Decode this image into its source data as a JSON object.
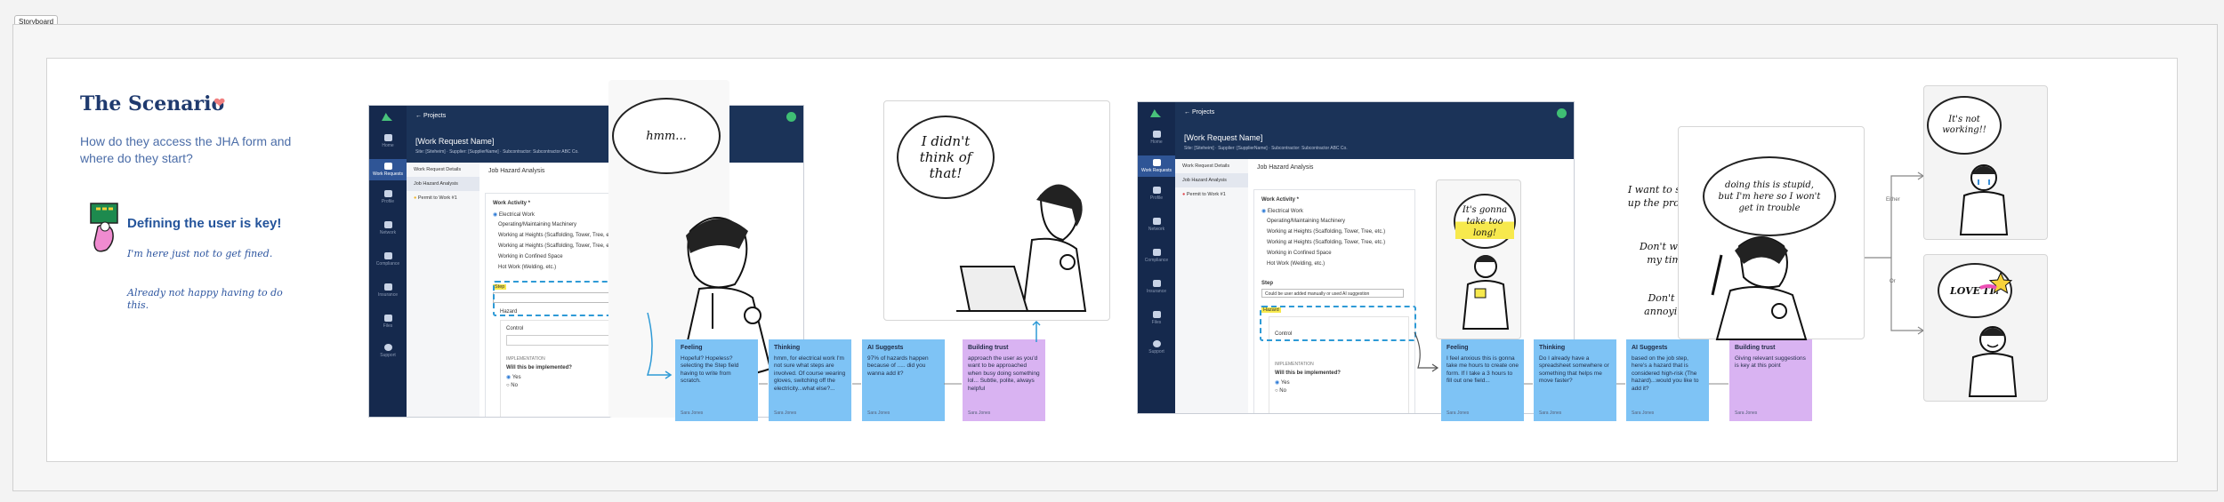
{
  "frame": {
    "label": "Storyboard"
  },
  "intro": {
    "title": "The Scenario",
    "question": "How do they access the JHA form and where do they start?",
    "key_point": "Defining the user is key!",
    "quotes": [
      "I'm here just not to get fined.",
      "Already not happy having to do this."
    ]
  },
  "app": {
    "nav": [
      "Home",
      "Work Requests",
      "Profile",
      "Network",
      "Compliance",
      "Insurance",
      "Files",
      "Support"
    ],
    "back_label": "Projects",
    "request_name": "[Work Request Name]",
    "request_meta": "Site: [Siteheim]  ·  Supplier: [SupplierName]  ·  Subcontractor: Subcontractor ABC Co.",
    "left_menu": [
      "Work Request Details",
      "Job Hazard Analysis",
      "Permit to Work #1"
    ],
    "section_title": "Job Hazard Analysis",
    "work_activity_label": "Work Activity *",
    "activities": [
      "Electrical Work",
      "Operating/Maintaining Machinery",
      "Working at Heights (Scaffolding, Tower, Tree, etc.)",
      "Working at Heights (Scaffolding, Tower, Tree, etc.)",
      "Working in Confined Space",
      "Hot Work (Welding, etc.)"
    ],
    "step_label": "Step",
    "hazard_label": "Hazard",
    "control_label": "Control",
    "implementation_label": "IMPLEMENTATION",
    "implemented_question": "Will this be implemented?",
    "yes": "Yes",
    "no": "No",
    "step_value_2": "Could be user added manually or used AI suggestion"
  },
  "panel1": {
    "cloud1": "hmm...",
    "cloud2": "I didn't think of that!",
    "stickies": [
      {
        "title": "Feeling",
        "body": "Hopeful? Hopeless? selecting the Step field having to write from scratch.",
        "sig": "Sara Jones"
      },
      {
        "title": "Thinking",
        "body": "hmm, for electrical work I'm not sure what steps are involved. Of course wearing gloves, switching off the electricity...what else?...",
        "sig": "Sara Jones"
      },
      {
        "title": "AI Suggests",
        "body": "97% of hazards happen because of ..... did you wanna add it?",
        "sig": "Sara Jones"
      },
      {
        "title": "Building trust",
        "body": "approach the user as you'd want to be approached when busy doing something lol... Subtle, polite, always helpful",
        "sig": "Sara Jones"
      }
    ]
  },
  "panel2": {
    "bubble": "It's gonna take too long!",
    "stickies": [
      {
        "title": "Feeling",
        "body": "I feel anxious this is gonna take me hours to create one form. If I take a 3 hours to fill out one field...",
        "sig": "Sara Jones"
      },
      {
        "title": "Thinking",
        "body": "Do I already have a spreadsheet somewhere or something that helps me move faster?",
        "sig": "Sara Jones"
      },
      {
        "title": "AI Suggests",
        "body": "based on the job step, here's a hazard that is considered high-risk (The hazard)...would you like to add it?",
        "sig": "Sara Jones"
      },
      {
        "title": "Building trust",
        "body": "Giving relevant suggestions is key at this point",
        "sig": "Sara Jones"
      }
    ]
  },
  "panel3": {
    "cloud": "doing this is stupid, but I'm here so I won't get in trouble",
    "thoughts": [
      "I want to speed up the process!",
      "Don't waste my time!",
      "Don't be annoying!"
    ],
    "branch_either": "Either",
    "branch_or": "Or",
    "outcome1": "It's not working!!",
    "outcome2": "LOVE IT!"
  }
}
